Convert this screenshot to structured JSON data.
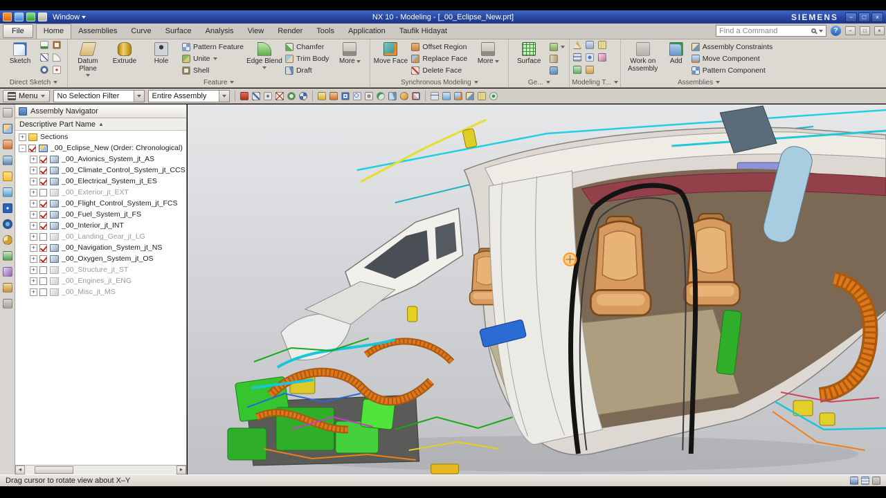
{
  "icons": {
    "minimize": "−",
    "maximize": "□",
    "close": "×",
    "help": "?",
    "sort": "▲",
    "scroll_left": "◄",
    "scroll_right": "►"
  },
  "title_bar": {
    "title": "NX 10 - Modeling - [_00_Eclipse_New.prt]",
    "brand": "SIEMENS",
    "window_menu": "Window"
  },
  "tabs": {
    "file": "File",
    "search_placeholder": "Find a Command",
    "items": [
      {
        "label": "Home",
        "active": true
      },
      {
        "label": "Assemblies"
      },
      {
        "label": "Curve"
      },
      {
        "label": "Surface"
      },
      {
        "label": "Analysis"
      },
      {
        "label": "View"
      },
      {
        "label": "Render"
      },
      {
        "label": "Tools"
      },
      {
        "label": "Application"
      },
      {
        "label": "Taufik Hidayat"
      }
    ]
  },
  "ribbon": {
    "direct_sketch": {
      "sketch": "Sketch",
      "label": "Direct Sketch"
    },
    "feature": {
      "datum_plane": "Datum Plane",
      "extrude": "Extrude",
      "hole": "Hole",
      "pattern_feature": "Pattern Feature",
      "unite": "Unite",
      "shell": "Shell",
      "edge_blend": "Edge Blend",
      "chamfer": "Chamfer",
      "trim_body": "Trim Body",
      "draft": "Draft",
      "more": "More",
      "label": "Feature"
    },
    "synchronous": {
      "move_face": "Move Face",
      "offset_region": "Offset Region",
      "replace_face": "Replace Face",
      "delete_face": "Delete Face",
      "more": "More",
      "label": "Synchronous Modeling"
    },
    "surface_group": {
      "surface": "Surface",
      "label": "Ge..."
    },
    "modeling_tools": {
      "label": "Modeling T..."
    },
    "assemblies": {
      "work_on": "Work on Assembly",
      "add": "Add",
      "assembly_constraints": "Assembly Constraints",
      "move_component": "Move Component",
      "pattern_component": "Pattern Component",
      "label": "Assemblies"
    }
  },
  "selection_bar": {
    "menu": "Menu",
    "filter": "No Selection Filter",
    "scope": "Entire Assembly"
  },
  "navigator": {
    "title": "Assembly Navigator",
    "column": "Descriptive Part Name",
    "rows": [
      {
        "label": "Sections",
        "icon": "folder",
        "expander": "+",
        "nocheck": true,
        "child": false,
        "dim": false
      },
      {
        "label": "_00_Eclipse_New (Order: Chronological)",
        "icon": "assembly",
        "expander": "-",
        "checked": true,
        "child": false,
        "dim": false
      },
      {
        "label": "_00_Avionics_System_jt_AS",
        "icon": "part",
        "expander": "+",
        "checked": true,
        "child": true,
        "dim": false
      },
      {
        "label": "_00_Climate_Control_System_jt_CCS",
        "icon": "part",
        "expander": "+",
        "checked": true,
        "child": true,
        "dim": false
      },
      {
        "label": "_00_Electrical_System_jt_ES",
        "icon": "part",
        "expander": "+",
        "checked": true,
        "child": true,
        "dim": false
      },
      {
        "label": "_00_Exterior_jt_EXT",
        "icon": "part",
        "expander": "+",
        "checked": false,
        "child": true,
        "dim": true
      },
      {
        "label": "_00_Flight_Control_System_jt_FCS",
        "icon": "part",
        "expander": "+",
        "checked": true,
        "child": true,
        "dim": false
      },
      {
        "label": "_00_Fuel_System_jt_FS",
        "icon": "part",
        "expander": "+",
        "checked": true,
        "child": true,
        "dim": false
      },
      {
        "label": "_00_Interior_jt_INT",
        "icon": "part",
        "expander": "+",
        "checked": true,
        "child": true,
        "dim": false
      },
      {
        "label": "_00_Landing_Gear_jt_LG",
        "icon": "part",
        "expander": "+",
        "checked": false,
        "child": true,
        "dim": true
      },
      {
        "label": "_00_Navigation_System_jt_NS",
        "icon": "part",
        "expander": "+",
        "checked": true,
        "child": true,
        "dim": false
      },
      {
        "label": "_00_Oxygen_System_jt_OS",
        "icon": "part",
        "expander": "+",
        "checked": true,
        "child": true,
        "dim": false
      },
      {
        "label": "_00_Structure_jt_ST",
        "icon": "part",
        "expander": "+",
        "checked": false,
        "child": true,
        "dim": true
      },
      {
        "label": "_00_Engines_jt_ENG",
        "icon": "part",
        "expander": "+",
        "checked": false,
        "child": true,
        "dim": true
      },
      {
        "label": "_00_Misc_jt_MS",
        "icon": "part",
        "expander": "+",
        "checked": false,
        "child": true,
        "dim": true
      }
    ]
  },
  "status_bar": {
    "message": "Drag cursor to rotate view about X–Y"
  }
}
